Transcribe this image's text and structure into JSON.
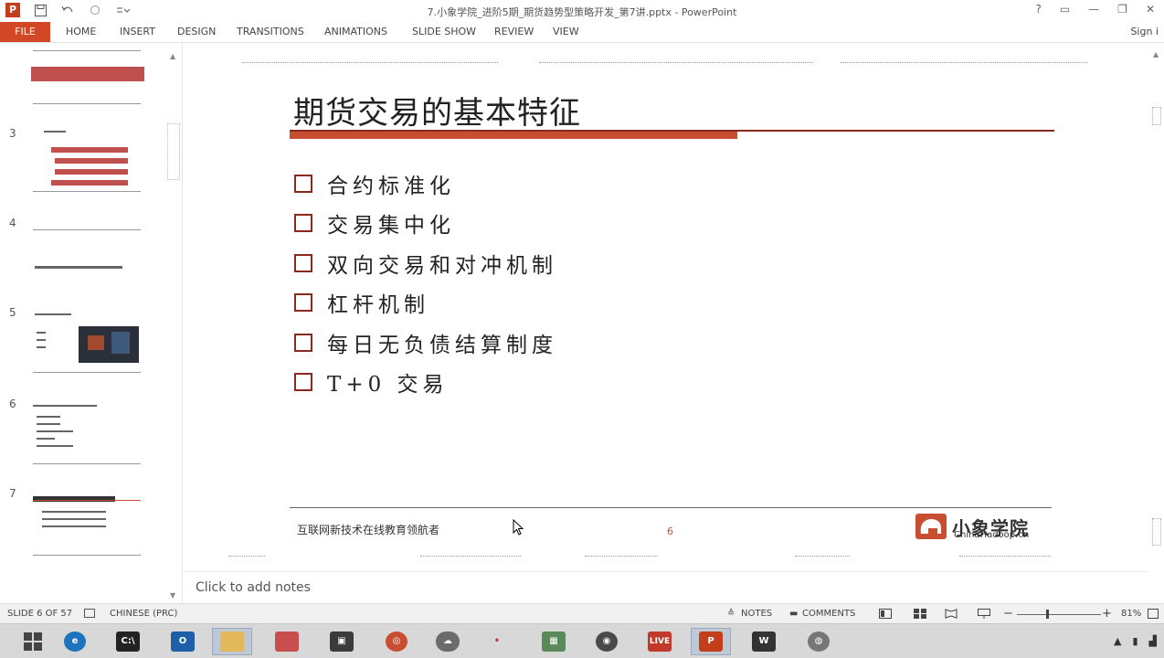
{
  "window": {
    "title": "7.小象学院_进阶5期_期货趋势型策略开发_第7讲.pptx - PowerPoint",
    "controls": [
      "?",
      "▭",
      "—",
      "❐",
      "✕"
    ]
  },
  "ribbon": {
    "file": "FILE",
    "tabs": [
      "HOME",
      "INSERT",
      "DESIGN",
      "TRANSITIONS",
      "ANIMATIONS",
      "SLIDE SHOW",
      "REVIEW",
      "VIEW"
    ],
    "signin": "Sign i"
  },
  "thumbnails": [
    {
      "number": ""
    },
    {
      "number": "3"
    },
    {
      "number": "4"
    },
    {
      "number": "5"
    },
    {
      "number": "6"
    },
    {
      "number": "7"
    }
  ],
  "slide": {
    "title": "期货交易的基本特征",
    "bullets": [
      "合约标准化",
      "交易集中化",
      "双向交易和对冲机制",
      "杠杆机制",
      "每日无负债结算制度",
      "T+0 交易"
    ],
    "footer_text": "互联网新技术在线教育领航者",
    "page_number": "6",
    "logo_cn": "小象学院",
    "logo_en": "ChinaHadoop.cn"
  },
  "notes": {
    "placeholder": "Click to add notes"
  },
  "status": {
    "slide_info": "SLIDE 6 OF 57",
    "language": "CHINESE (PRC)",
    "notes": "NOTES",
    "comments": "COMMENTS",
    "zoom": "81%"
  },
  "colors": {
    "accent": "#c84e32",
    "file_tab": "#d24726",
    "title_rule": "#8a2a1f"
  }
}
